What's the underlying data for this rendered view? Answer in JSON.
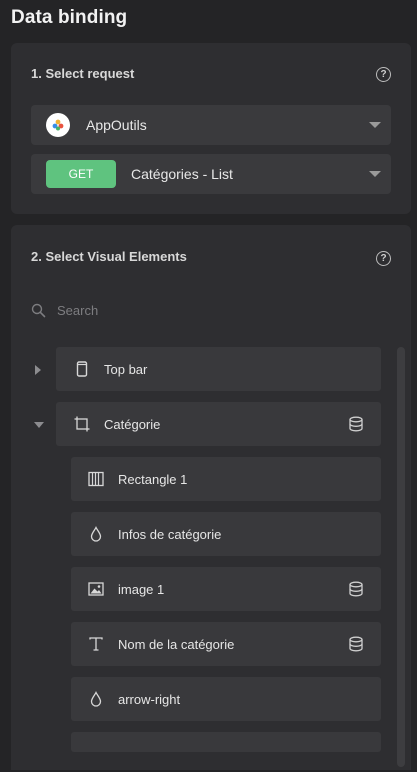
{
  "title": "Data binding",
  "section1": {
    "title": "1. Select request",
    "app_select": {
      "label": "AppOutils"
    },
    "request_select": {
      "method": "GET",
      "label": "Catégories - List"
    }
  },
  "section2": {
    "title": "2. Select Visual Elements",
    "search": {
      "placeholder": "Search"
    },
    "elements": [
      {
        "label": "Top bar",
        "icon": "phone-icon",
        "expanded": false,
        "bound": false
      },
      {
        "label": "Catégorie",
        "icon": "frame-icon",
        "expanded": true,
        "bound": true
      },
      {
        "label": "Rectangle 1",
        "icon": "rectangle-pattern-icon",
        "bound": false
      },
      {
        "label": "Infos de catégorie",
        "icon": "drop-icon",
        "bound": false
      },
      {
        "label": "image 1",
        "icon": "image-icon",
        "bound": true
      },
      {
        "label": "Nom de la catégorie",
        "icon": "text-icon",
        "bound": true
      },
      {
        "label": "arrow-right",
        "icon": "drop-icon",
        "bound": false
      }
    ]
  },
  "colors": {
    "background": "#242426",
    "panel": "#2e2e31",
    "row": "#39393c",
    "get_badge": "#5fc37f"
  }
}
